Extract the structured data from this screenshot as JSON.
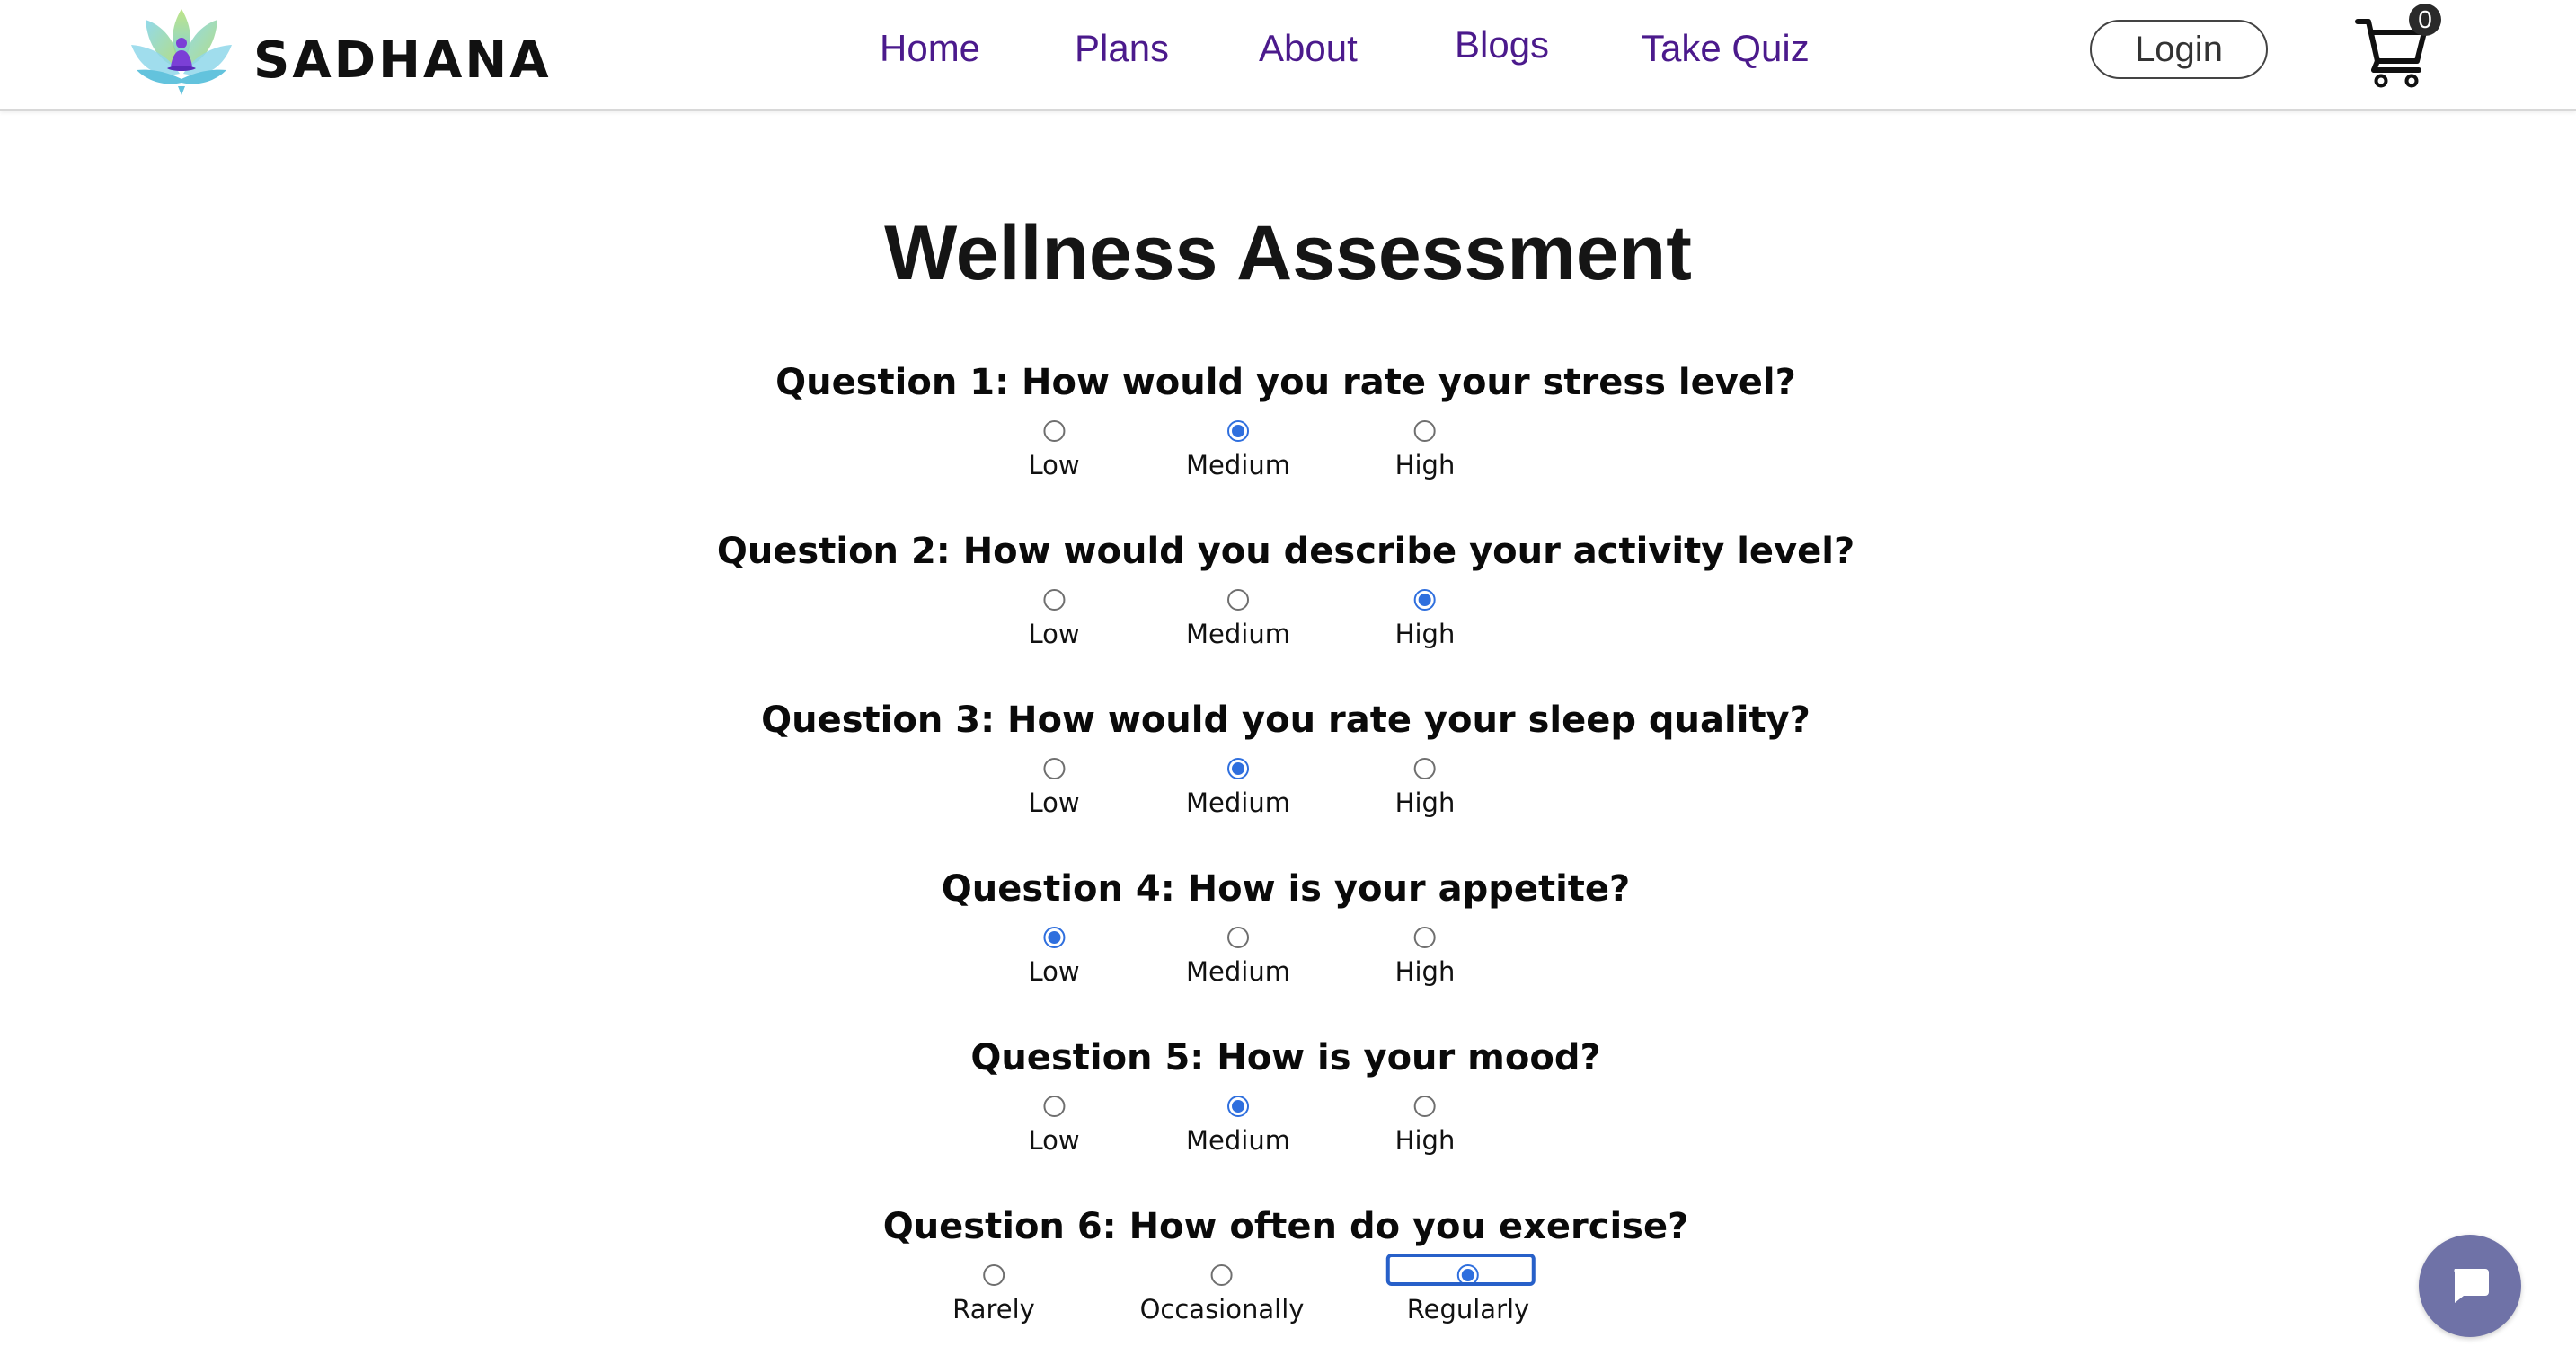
{
  "header": {
    "brand": "SADHANA",
    "nav": [
      {
        "label": "Home"
      },
      {
        "label": "Plans"
      },
      {
        "label": "About"
      },
      {
        "label": "Blogs"
      },
      {
        "label": "Take Quiz"
      }
    ],
    "login_label": "Login",
    "cart_count": "0",
    "icons": {
      "logo": "lotus-meditation-logo",
      "cart": "shopping-cart-icon"
    }
  },
  "page_title": "Wellness Assessment",
  "questions": [
    {
      "text": "Question 1: How would you rate your stress level?",
      "options": [
        "Low",
        "Medium",
        "High"
      ],
      "selected": "Medium"
    },
    {
      "text": "Question 2: How would you describe your activity level?",
      "options": [
        "Low",
        "Medium",
        "High"
      ],
      "selected": "High"
    },
    {
      "text": "Question 3: How would you rate your sleep quality?",
      "options": [
        "Low",
        "Medium",
        "High"
      ],
      "selected": "Medium"
    },
    {
      "text": "Question 4: How is your appetite?",
      "options": [
        "Low",
        "Medium",
        "High"
      ],
      "selected": "Low"
    },
    {
      "text": "Question 5: How is your mood?",
      "options": [
        "Low",
        "Medium",
        "High"
      ],
      "selected": "Medium"
    },
    {
      "text": "Question 6: How often do you exercise?",
      "options": [
        "Rarely",
        "Occasionally",
        "Regularly"
      ],
      "selected": "Regularly"
    }
  ],
  "chat_icon": "chat-bubble-icon",
  "colors": {
    "nav_text": "#4b1a8c",
    "radio_checked": "#2f6fde",
    "chat_button": "#6f72a7"
  }
}
